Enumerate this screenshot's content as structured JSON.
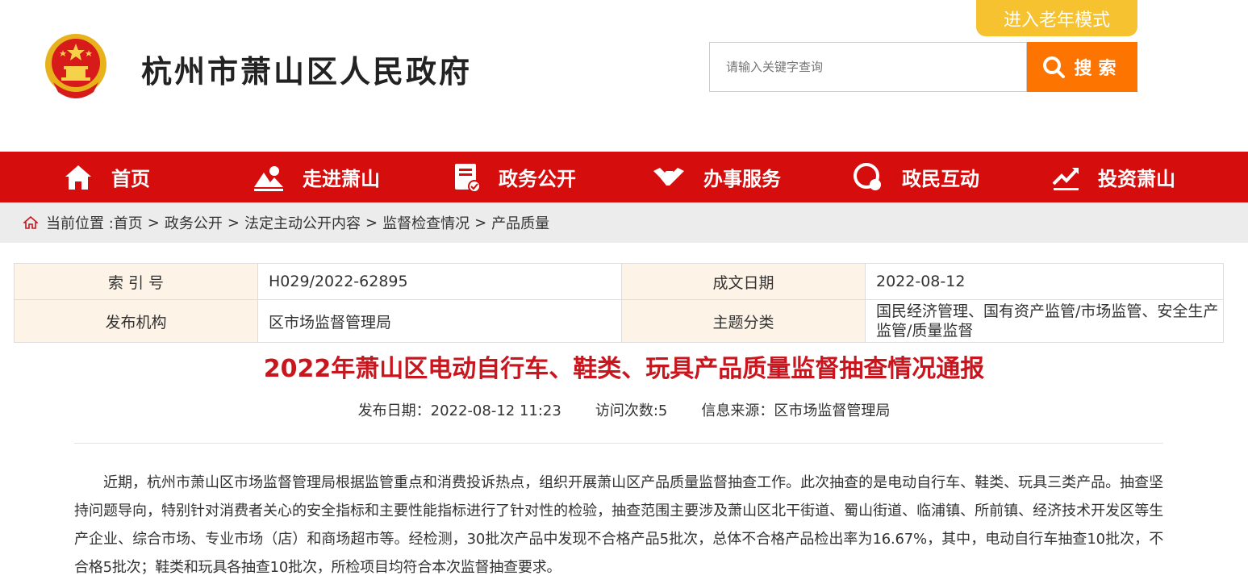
{
  "header": {
    "site_title": "杭州市萧山区人民政府",
    "elder_mode_label": "进入老年模式",
    "search_placeholder": "请输入关键字查询",
    "search_button_label": "搜索",
    "brand_color": "#d60d0d",
    "accent_orange": "#fd7400",
    "elder_button_color": "#f7c22f"
  },
  "nav": {
    "items": [
      {
        "label": "首页",
        "icon": "home-icon"
      },
      {
        "label": "走进萧山",
        "icon": "landscape-icon"
      },
      {
        "label": "政务公开",
        "icon": "document-icon"
      },
      {
        "label": "办事服务",
        "icon": "handshake-icon"
      },
      {
        "label": "政民互动",
        "icon": "chat-icon"
      },
      {
        "label": "投资萧山",
        "icon": "chart-trend-icon"
      }
    ]
  },
  "breadcrumb": {
    "prefix": "当前位置 :",
    "items": [
      "首页",
      "政务公开",
      "法定主动公开内容",
      "监督检查情况",
      "产品质量"
    ]
  },
  "info": {
    "index_label": "索 引 号",
    "index_value": "H029/2022-62895",
    "date_label": "成文日期",
    "date_value": "2022-08-12",
    "publisher_label": "发布机构",
    "publisher_value": "区市场监督管理局",
    "topic_label": "主题分类",
    "topic_value": "国民经济管理、国有资产监管/市场监管、安全生产监管/质量监督"
  },
  "article": {
    "title": "2022年萧山区电动自行车、鞋类、玩具产品质量监督抽查情况通报",
    "publish_date": "发布日期：2022-08-12 11:23",
    "visits": "访问次数:5",
    "source": "信息来源：区市场监督管理局",
    "paragraph": "近期，杭州市萧山区市场监督管理局根据监管重点和消费投诉热点，组织开展萧山区产品质量监督抽查工作。此次抽查的是电动自行车、鞋类、玩具三类产品。抽查坚持问题导向，特别针对消费者关心的安全指标和主要性能指标进行了针对性的检验，抽查范围主要涉及萧山区北干街道、蜀山街道、临浦镇、所前镇、经济技术开发区等生产企业、综合市场、专业市场（店）和商场超市等。经检测，30批次产品中发现不合格产品5批次，总体不合格产品检出率为16.67%，其中，电动自行车抽查10批次，不合格5批次；鞋类和玩具各抽查10批次，所检项目均符合本次监督抽查要求。",
    "title_color": "#c9161e"
  }
}
